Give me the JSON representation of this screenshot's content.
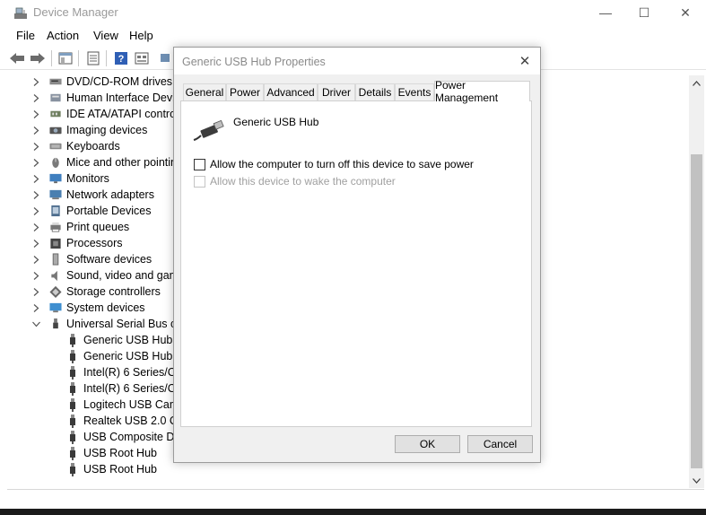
{
  "window": {
    "title": "Device Manager",
    "minimize": "—",
    "maximize": "☐",
    "close": "✕"
  },
  "menu": [
    "File",
    "Action",
    "View",
    "Help"
  ],
  "tree": {
    "items": [
      {
        "label": "DVD/CD-ROM drives",
        "icon": "dvd-drive-icon",
        "expanded": false
      },
      {
        "label": "Human Interface Devic",
        "icon": "hid-icon",
        "expanded": false
      },
      {
        "label": "IDE ATA/ATAPI controll",
        "icon": "ide-controller-icon",
        "expanded": false
      },
      {
        "label": "Imaging devices",
        "icon": "camera-icon",
        "expanded": false
      },
      {
        "label": "Keyboards",
        "icon": "keyboard-icon",
        "expanded": false
      },
      {
        "label": "Mice and other pointin",
        "icon": "mouse-icon",
        "expanded": false
      },
      {
        "label": "Monitors",
        "icon": "monitor-icon",
        "expanded": false
      },
      {
        "label": "Network adapters",
        "icon": "network-adapter-icon",
        "expanded": false
      },
      {
        "label": "Portable Devices",
        "icon": "portable-device-icon",
        "expanded": false
      },
      {
        "label": "Print queues",
        "icon": "printer-icon",
        "expanded": false
      },
      {
        "label": "Processors",
        "icon": "processor-icon",
        "expanded": false
      },
      {
        "label": "Software devices",
        "icon": "software-device-icon",
        "expanded": false
      },
      {
        "label": "Sound, video and game",
        "icon": "speaker-icon",
        "expanded": false
      },
      {
        "label": "Storage controllers",
        "icon": "storage-controller-icon",
        "expanded": false
      },
      {
        "label": "System devices",
        "icon": "system-device-icon",
        "expanded": false
      },
      {
        "label": "Universal Serial Bus cor",
        "icon": "usb-icon",
        "expanded": true
      }
    ],
    "usb_children": [
      "Generic USB Hub",
      "Generic USB Hub",
      "Intel(R) 6 Series/C20",
      "Intel(R) 6 Series/C20",
      "Logitech USB Came",
      "Realtek USB 2.0 Car",
      "USB Composite Dev",
      "USB Root Hub",
      "USB Root Hub"
    ]
  },
  "dialog": {
    "title": "Generic USB Hub Properties",
    "close": "✕",
    "tabs": [
      "General",
      "Power",
      "Advanced",
      "Driver",
      "Details",
      "Events",
      "Power Management"
    ],
    "active_tab": "Power Management",
    "device_name": "Generic USB Hub",
    "options": [
      {
        "label": "Allow the computer to turn off this device to save power",
        "checked": false,
        "enabled": true
      },
      {
        "label": "Allow this device to wake the computer",
        "checked": false,
        "enabled": false
      }
    ],
    "ok": "OK",
    "cancel": "Cancel"
  }
}
